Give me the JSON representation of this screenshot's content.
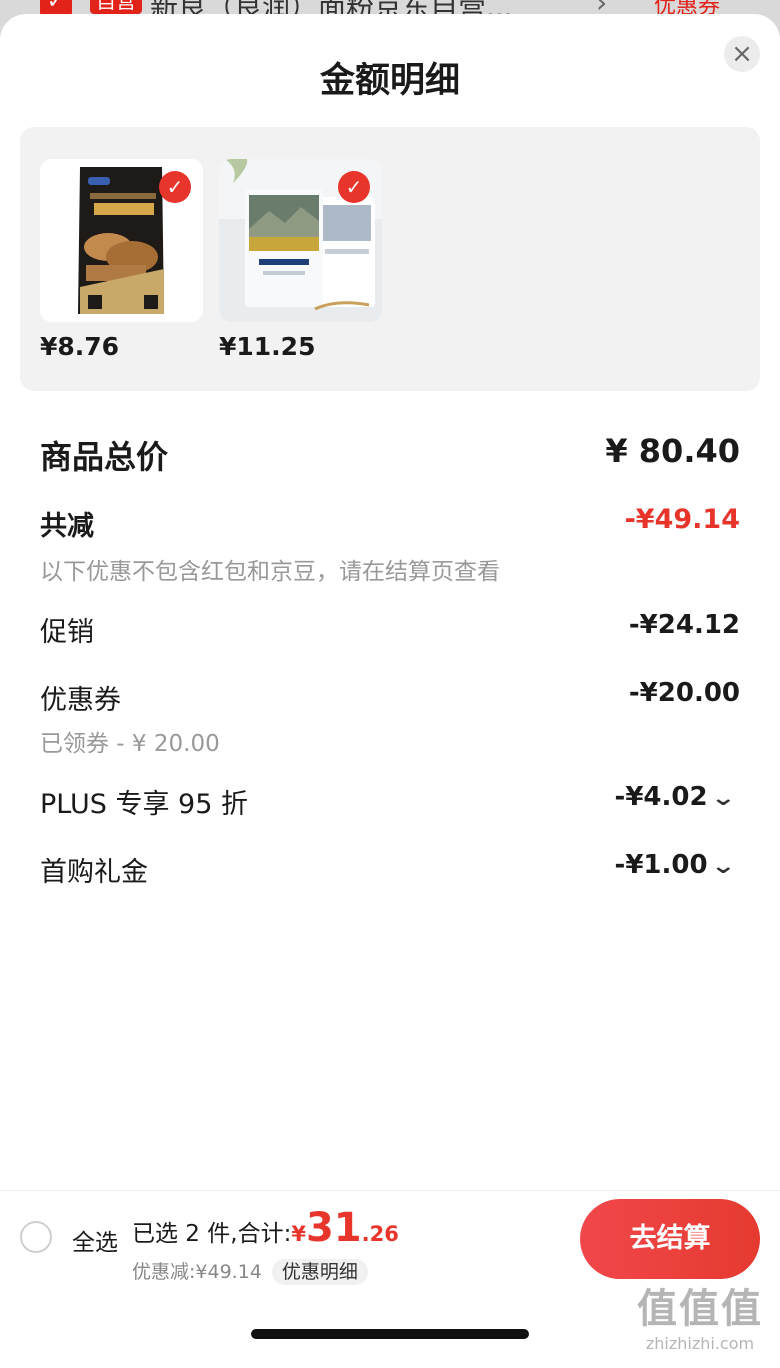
{
  "backdrop": {
    "badge": "自营",
    "title": "新良（良润）面粉京东自营...",
    "coupon": "优惠券"
  },
  "sheet": {
    "title": "金额明细"
  },
  "products": [
    {
      "price": "¥8.76",
      "image_desc": "dark bread flour bag"
    },
    {
      "price": "¥11.25",
      "image_desc": "white flour bags"
    }
  ],
  "summary": {
    "total_label": "商品总价",
    "total_value": "¥ 80.40",
    "reduce_label": "共减",
    "reduce_value": "-¥49.14",
    "note": "以下优惠不包含红包和京豆，请在结算页查看",
    "items": [
      {
        "label": "促销",
        "value": "-¥24.12",
        "expandable": false
      },
      {
        "label": "优惠券",
        "value": "-¥20.00",
        "sub": "已领券 - ¥ 20.00",
        "expandable": false
      },
      {
        "label": "PLUS 专享 95 折",
        "value": "-¥4.02",
        "expandable": true
      },
      {
        "label": "首购礼金",
        "value": "-¥1.00",
        "expandable": true
      }
    ]
  },
  "bottom_bar": {
    "select_all": "全选",
    "selected_text": "已选 2 件,合计:",
    "currency": "¥",
    "amount_int": "31",
    "amount_dec": ".26",
    "discount_text": "优惠减:¥49.14",
    "detail_chip": "优惠明细",
    "checkout": "去结算"
  },
  "watermark": {
    "glyphs": "值值值",
    "url": "zhizhizhi.com"
  },
  "colors": {
    "accent_red": "#e8352b",
    "panel_bg": "#f2f2f2",
    "muted_text": "#999999"
  }
}
